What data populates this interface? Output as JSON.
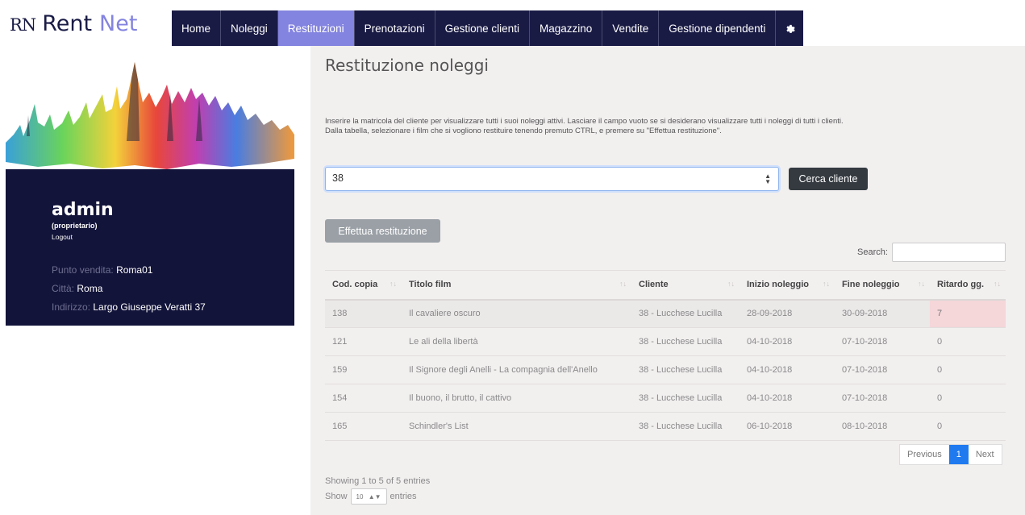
{
  "brand": {
    "mark": "RN",
    "name_a": "Rent",
    "name_b": "Net"
  },
  "nav": {
    "items": [
      "Home",
      "Noleggi",
      "Restituzioni",
      "Prenotazioni",
      "Gestione clienti",
      "Magazzino",
      "Vendite",
      "Gestione dipendenti"
    ],
    "active_index": 2,
    "gear_icon": "gear-icon"
  },
  "sidebar": {
    "user": "admin",
    "role": "(proprietario)",
    "logout": "Logout",
    "store_label": "Punto vendita:",
    "store": "Roma01",
    "city_label": "Città:",
    "city": "Roma",
    "address_label": "Indirizzo:",
    "address": "Largo Giuseppe Veratti 37"
  },
  "main": {
    "title": "Restituzione noleggi",
    "instructions_1": "Inserire la matricola del cliente per visualizzare tutti i suoi noleggi attivi. Lasciare il campo vuoto se si desiderano visualizzare tutti i noleggi di tutti i clienti.",
    "instructions_2": "Dalla tabella, selezionare i film che si vogliono restituire tenendo premuto CTRL, e premere su \"Effettua restituzione\".",
    "client_value": "38",
    "search_button": "Cerca cliente",
    "return_button": "Effettua restituzione",
    "table_search_label": "Search:",
    "table_search_value": ""
  },
  "table": {
    "headers": [
      "Cod. copia",
      "Titolo film",
      "Cliente",
      "Inizio noleggio",
      "Fine noleggio",
      "Ritardo gg."
    ],
    "rows": [
      [
        "138",
        "Il cavaliere oscuro",
        "38 - Lucchese Lucilla",
        "28-09-2018",
        "30-09-2018",
        "7"
      ],
      [
        "121",
        "Le ali della libertà",
        "38 - Lucchese Lucilla",
        "04-10-2018",
        "07-10-2018",
        "0"
      ],
      [
        "159",
        "Il Signore degli Anelli - La compagnia dell'Anello",
        "38 - Lucchese Lucilla",
        "04-10-2018",
        "07-10-2018",
        "0"
      ],
      [
        "154",
        "Il buono, il brutto, il cattivo",
        "38 - Lucchese Lucilla",
        "04-10-2018",
        "07-10-2018",
        "0"
      ],
      [
        "165",
        "Schindler's List",
        "38 - Lucchese Lucilla",
        "06-10-2018",
        "08-10-2018",
        "0"
      ]
    ],
    "late_color": "#f5d6d9"
  },
  "pagination": {
    "previous": "Previous",
    "current": "1",
    "next": "Next"
  },
  "footer": {
    "showing": "Showing 1 to 5 of 5 entries",
    "show": "Show",
    "length": "10",
    "entries": "entries"
  },
  "colors": {
    "navy": "#1a1b45",
    "accent": "#8383e0",
    "panel": "#13143a",
    "page_bg": "#f2efef"
  }
}
